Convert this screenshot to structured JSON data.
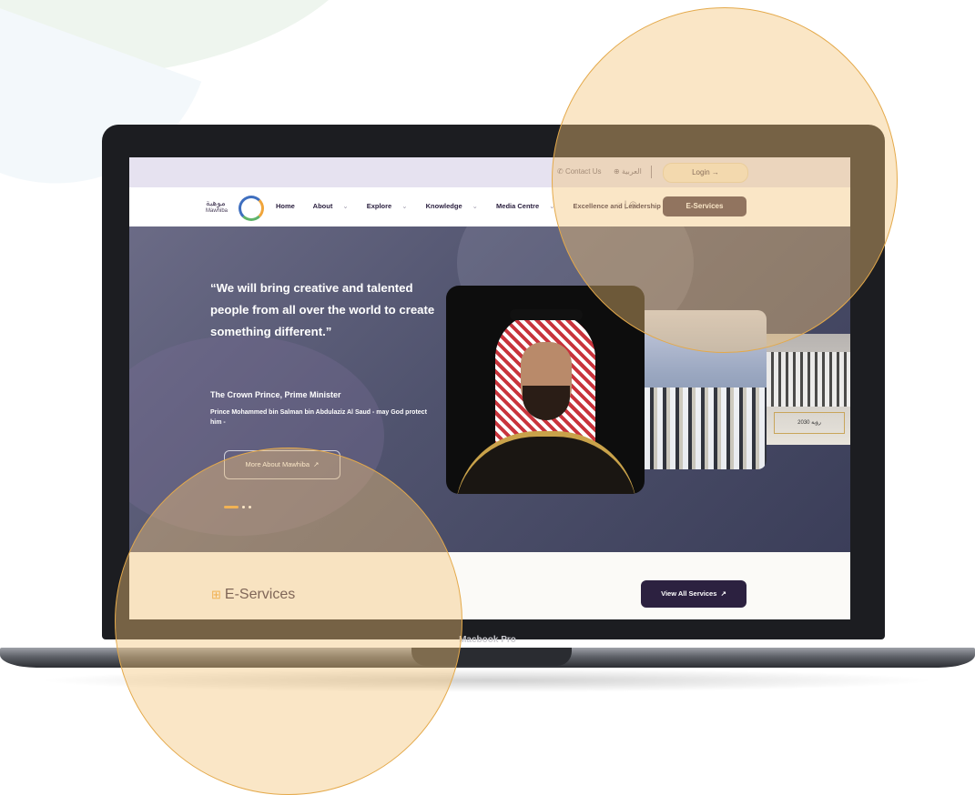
{
  "device": {
    "label": "Macbook Pro"
  },
  "topbar": {
    "contact_label": "Contact Us",
    "language_label": "العربية",
    "login_label": "Login"
  },
  "logo": {
    "arabic": "موهبة",
    "english": "Mawhiba"
  },
  "nav": {
    "items": [
      {
        "label": "Home",
        "dropdown": false
      },
      {
        "label": "About",
        "dropdown": true
      },
      {
        "label": "Explore",
        "dropdown": true
      },
      {
        "label": "Knowledge",
        "dropdown": true
      },
      {
        "label": "Media Centre",
        "dropdown": true
      },
      {
        "label": "Excellence and Leadership",
        "dropdown": true
      }
    ],
    "eservices_label": "E-Services"
  },
  "hero": {
    "quote": "“We will bring creative and talented people from all over the world to create something different.”",
    "attribution_title": "The Crown Prince, Prime Minister",
    "attribution_sub": "Prince Mohammed bin Salman bin Abdulaziz Al Saud - may God protect him -",
    "button_label": "More About Mawhiba",
    "plaque_text": "2030 رؤية"
  },
  "services": {
    "title": "E-Services",
    "view_all_label": "View All Services"
  },
  "colors": {
    "accent": "#f0a53b",
    "brand_dark": "#2c2140",
    "eservices_button": "#4a3b4f",
    "highlight": "#f2c478"
  }
}
